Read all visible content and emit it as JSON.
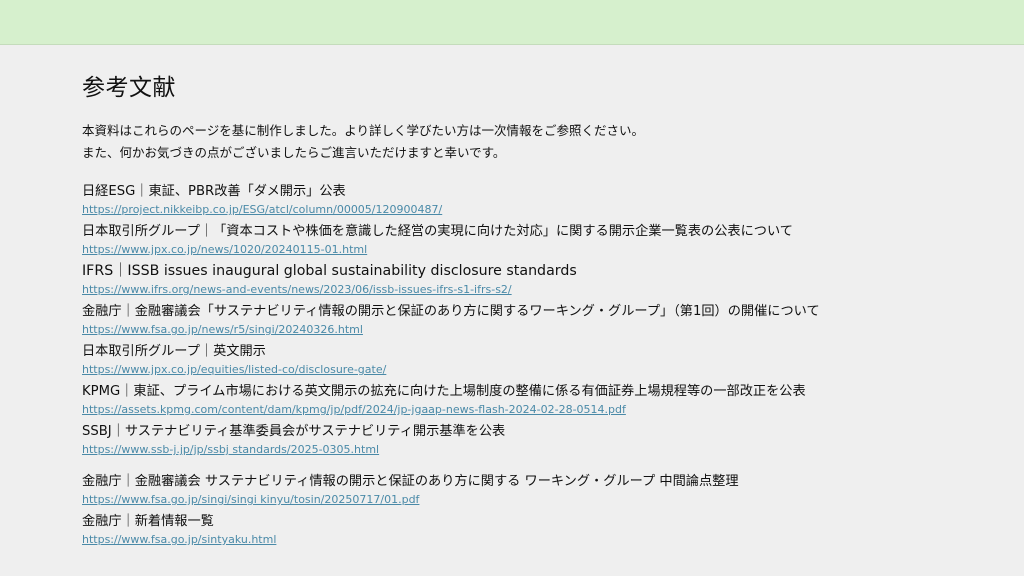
{
  "page": {
    "title": "参考文献",
    "intro": [
      "本資料はこれらのページを基に制作しました。より詳しく学びたい方は一次情報をご参照ください。",
      "また、何かお気づきの点がございましたらご進言いただけますと幸いです。"
    ]
  },
  "references": [
    {
      "title": "日経ESG｜東証、PBR改善「ダメ開示」公表",
      "url": "https://project.nikkeibp.co.jp/ESG/atcl/column/00005/120900487/"
    },
    {
      "title": "日本取引所グループ｜「資本コストや株価を意識した経営の実現に向けた対応」に関する開示企業一覧表の公表について",
      "url": "https://www.jpx.co.jp/news/1020/20240115-01.html"
    },
    {
      "title": "IFRS｜ISSB issues inaugural global sustainability disclosure standards",
      "url": "https://www.ifrs.org/news-and-events/news/2023/06/issb-issues-ifrs-s1-ifrs-s2/"
    },
    {
      "title": "金融庁｜金融審議会「サステナビリティ情報の開示と保証のあり方に関するワーキング・グループ」（第1回）の開催について",
      "url": "https://www.fsa.go.jp/news/r5/singi/20240326.html"
    },
    {
      "title": "日本取引所グループ｜英文開示",
      "url": "https://www.jpx.co.jp/equities/listed-co/disclosure-gate/"
    },
    {
      "title": "KPMG｜東証、プライム市場における英文開示の拡充に向けた上場制度の整備に係る有価証券上場規程等の一部改正を公表",
      "url": "https://assets.kpmg.com/content/dam/kpmg/jp/pdf/2024/jp-jgaap-news-flash-2024-02-28-0514.pdf"
    },
    {
      "title": "SSBJ｜サステナビリティ基準委員会がサステナビリティ開示基準を公表",
      "url": "https://www.ssb-j.jp/jp/ssbj standards/2025-0305.html"
    },
    {
      "title": "金融庁｜金融審議会 サステナビリティ情報の開示と保証のあり方に関する ワーキング・グループ 中間論点整理",
      "url": "https://www.fsa.go.jp/singi/singi kinyu/tosin/20250717/01.pdf"
    },
    {
      "title": "金融庁｜新着情報一覧",
      "url": "https://www.fsa.go.jp/sintyaku.html"
    }
  ]
}
